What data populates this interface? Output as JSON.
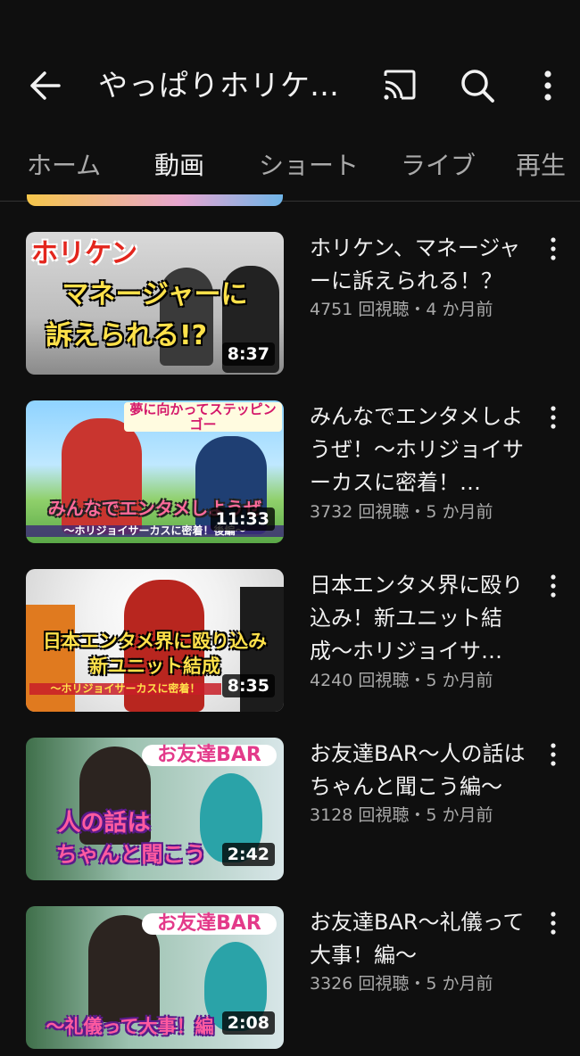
{
  "header": {
    "channel_title": "やっぱりホリケン…"
  },
  "tabs": [
    {
      "label": "ホーム"
    },
    {
      "label": "動画"
    },
    {
      "label": "ショート"
    },
    {
      "label": "ライブ"
    },
    {
      "label": "再生"
    }
  ],
  "videos": [
    {
      "title": "ホリケン、マネージャーに訴えられる！？",
      "views": "4751 回視聴",
      "age": "4 か月前",
      "duration": "8:37",
      "thumb_text": "ホリケン",
      "thumb_text2": "マネージャーに",
      "thumb_text3": "訴えられる!?"
    },
    {
      "title": "みんなでエンタメしようぜ！〜ホリジョイサーカスに密着！…",
      "views": "3732 回視聴",
      "age": "5 か月前",
      "duration": "11:33",
      "thumb_text": "夢に向かってステッピンゴー",
      "thumb_text2": "みんなでエンタメしようぜ",
      "thumb_text3": "〜ホリジョイサーカスに密着！後編〜"
    },
    {
      "title": "日本エンタメ界に殴り込み！新ユニット結成〜ホリジョイサ…",
      "views": "4240 回視聴",
      "age": "5 か月前",
      "duration": "8:35",
      "thumb_text": "日本エンタメ界に殴り込み",
      "thumb_text2": "新ユニット結成",
      "thumb_text3": "〜ホリジョイサーカスに密着！"
    },
    {
      "title": "お友達BAR〜人の話はちゃんと聞こう編〜",
      "views": "3128 回視聴",
      "age": "5 か月前",
      "duration": "2:42",
      "thumb_text": "お友達BAR",
      "thumb_text2": "人の話は",
      "thumb_text3": "ちゃんと聞こう"
    },
    {
      "title": "お友達BAR〜礼儀って大事！編〜",
      "views": "3326 回視聴",
      "age": "5 か月前",
      "duration": "2:08",
      "thumb_text": "お友達BAR",
      "thumb_text2": "〜礼儀って大事！編",
      "thumb_text3": ""
    }
  ],
  "meta_separator": "・",
  "icons": [
    "back-arrow-icon",
    "cast-icon",
    "search-icon",
    "more-vert-icon",
    "kebab-menu-icon"
  ]
}
